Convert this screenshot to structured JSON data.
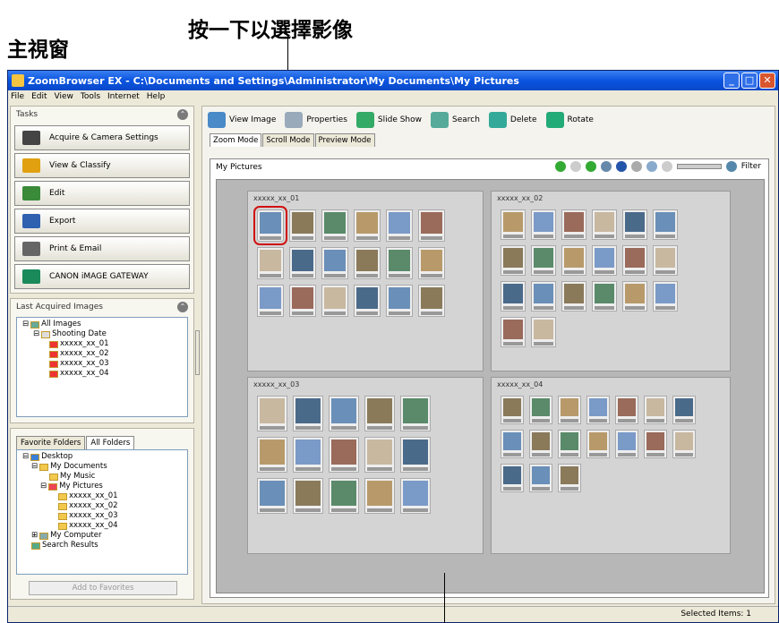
{
  "callout_top": "按一下以選擇影像",
  "main_window_label": "主視窗",
  "window": {
    "title": "ZoomBrowser EX - C:\\Documents and Settings\\Administrator\\My Documents\\My Pictures"
  },
  "menu": [
    "File",
    "Edit",
    "View",
    "Tools",
    "Internet",
    "Help"
  ],
  "tasks": {
    "header": "Tasks",
    "buttons": [
      {
        "label": "Acquire & Camera Settings",
        "icon": "camera-icon",
        "color": "#444444"
      },
      {
        "label": "View & Classify",
        "icon": "view-icon",
        "color": "#e0a010"
      },
      {
        "label": "Edit",
        "icon": "edit-icon",
        "color": "#3a8a3a"
      },
      {
        "label": "Export",
        "icon": "export-icon",
        "color": "#3060b0"
      },
      {
        "label": "Print & Email",
        "icon": "print-icon",
        "color": "#666666"
      },
      {
        "label": "CANON iMAGE GATEWAY",
        "icon": "gateway-icon",
        "color": "#1a8a5a"
      }
    ]
  },
  "last_acquired": {
    "header": "Last Acquired Images",
    "tree": {
      "all_images": "All Images",
      "shooting_date": "Shooting Date",
      "dates": [
        "xxxxx_xx_01",
        "xxxxx_xx_02",
        "xxxxx_xx_03",
        "xxxxx_xx_04"
      ]
    }
  },
  "folders": {
    "tabs": [
      "Favorite Folders",
      "All Folders"
    ],
    "tree": {
      "desktop": "Desktop",
      "my_documents": "My Documents",
      "my_music": "My Music",
      "my_pictures": "My Pictures",
      "subfolders": [
        "xxxxx_xx_01",
        "xxxxx_xx_02",
        "xxxxx_xx_03",
        "xxxxx_xx_04"
      ],
      "my_computer": "My Computer",
      "search_results": "Search Results"
    },
    "add_favorites": "Add to Favorites"
  },
  "toolbar": [
    "View Image",
    "Properties",
    "Slide Show",
    "Search",
    "Delete",
    "Rotate"
  ],
  "mode_tabs": [
    "Zoom Mode",
    "Scroll Mode",
    "Preview Mode"
  ],
  "view": {
    "breadcrumb": "My Pictures",
    "filter": "Filter"
  },
  "groups": [
    {
      "title": "xxxxx_xx_01",
      "count": 18
    },
    {
      "title": "xxxxx_xx_02",
      "count": 20
    },
    {
      "title": "xxxxx_xx_03",
      "count": 15
    },
    {
      "title": "xxxxx_xx_04",
      "count": 17
    }
  ],
  "status": {
    "selected": "Selected Items: 1"
  },
  "colors": {
    "accent_selection": "#d01010",
    "titlebar": "#0a54e0"
  }
}
